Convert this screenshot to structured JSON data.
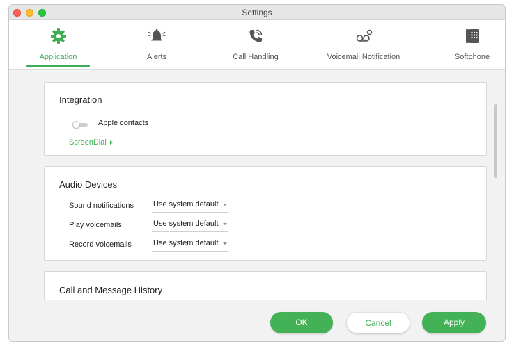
{
  "window": {
    "title": "Settings"
  },
  "tabs": [
    {
      "label": "Application",
      "icon": "gear-icon"
    },
    {
      "label": "Alerts",
      "icon": "bell-icon"
    },
    {
      "label": "Call Handling",
      "icon": "phone-icon"
    },
    {
      "label": "Voicemail Notification",
      "icon": "voicemail-icon"
    },
    {
      "label": "Softphone",
      "icon": "keypad-icon"
    }
  ],
  "integration": {
    "title": "Integration",
    "apple_contacts_label": "Apple contacts",
    "apple_contacts_enabled": false,
    "screendial_link": "ScreenDial"
  },
  "audio_devices": {
    "title": "Audio Devices",
    "rows": [
      {
        "label": "Sound notifications",
        "value": "Use system default"
      },
      {
        "label": "Play voicemails",
        "value": "Use system default"
      },
      {
        "label": "Record voicemails",
        "value": "Use system default"
      }
    ]
  },
  "history": {
    "title": "Call and Message History"
  },
  "buttons": {
    "ok": "OK",
    "cancel": "Cancel",
    "apply": "Apply"
  },
  "colors": {
    "accent": "#3eae54",
    "button_primary": "#43b155",
    "window_bg": "#f2f2f2"
  }
}
